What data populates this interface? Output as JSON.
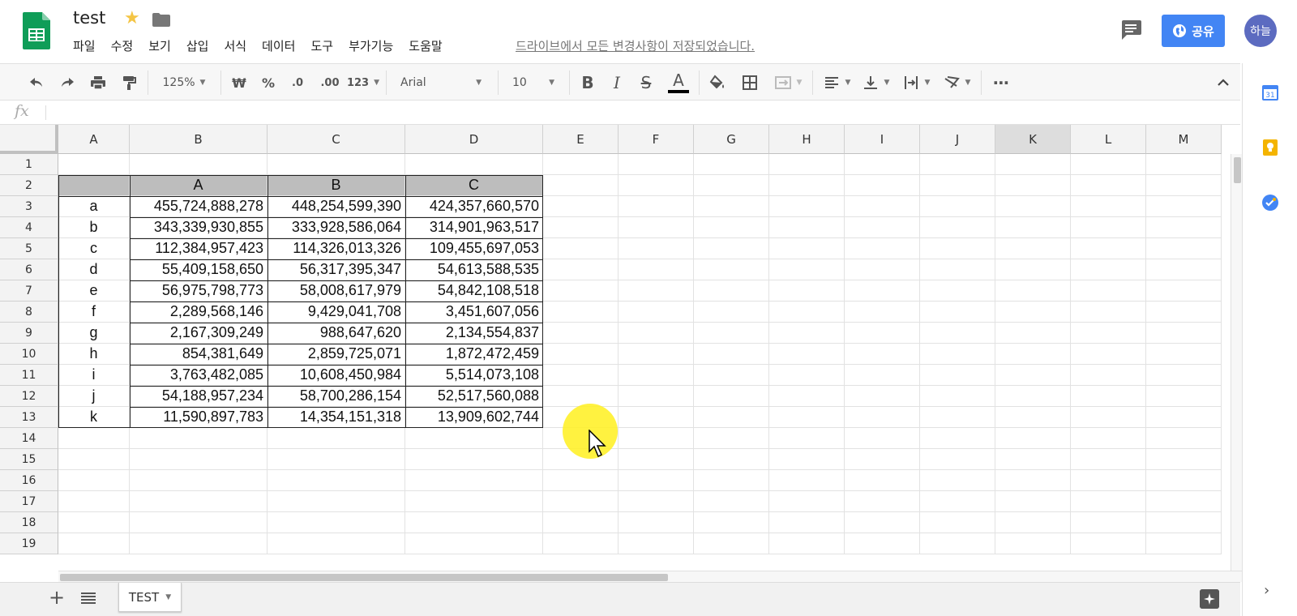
{
  "doc": {
    "title": "test",
    "saved_status": "드라이브에서 모든 변경사항이 저장되었습니다."
  },
  "menu": [
    "파일",
    "수정",
    "보기",
    "삽입",
    "서식",
    "데이터",
    "도구",
    "부가기능",
    "도움말"
  ],
  "header": {
    "share_label": "공유",
    "avatar_label": "하늘"
  },
  "toolbar": {
    "zoom": "125%",
    "currency": "₩",
    "percent": "%",
    "dec_dec": ".0",
    "dec_inc": ".00",
    "format_more": "123",
    "font_name": "Arial",
    "font_size": "10",
    "bold": "B",
    "italic": "I",
    "strike": "S",
    "text_color": "A",
    "more": "⋯"
  },
  "formula": {
    "fx": "fx"
  },
  "columns": [
    "A",
    "B",
    "C",
    "D",
    "E",
    "F",
    "G",
    "H",
    "I",
    "J",
    "K",
    "L",
    "M"
  ],
  "rows": [
    "1",
    "2",
    "3",
    "4",
    "5",
    "6",
    "7",
    "8",
    "9",
    "10",
    "11",
    "12",
    "13",
    "14",
    "15",
    "16",
    "17",
    "18",
    "19"
  ],
  "selected_column": "K",
  "table": {
    "headers": [
      "A",
      "B",
      "C"
    ],
    "rows": [
      {
        "label": "a",
        "values": [
          "455,724,888,278",
          "448,254,599,390",
          "424,357,660,570"
        ]
      },
      {
        "label": "b",
        "values": [
          "343,339,930,855",
          "333,928,586,064",
          "314,901,963,517"
        ]
      },
      {
        "label": "c",
        "values": [
          "112,384,957,423",
          "114,326,013,326",
          "109,455,697,053"
        ]
      },
      {
        "label": "d",
        "values": [
          "55,409,158,650",
          "56,317,395,347",
          "54,613,588,535"
        ]
      },
      {
        "label": "e",
        "values": [
          "56,975,798,773",
          "58,008,617,979",
          "54,842,108,518"
        ]
      },
      {
        "label": "f",
        "values": [
          "2,289,568,146",
          "9,429,041,708",
          "3,451,607,056"
        ]
      },
      {
        "label": "g",
        "values": [
          "2,167,309,249",
          "988,647,620",
          "2,134,554,837"
        ]
      },
      {
        "label": "h",
        "values": [
          "854,381,649",
          "2,859,725,071",
          "1,872,472,459"
        ]
      },
      {
        "label": "i",
        "values": [
          "3,763,482,085",
          "10,608,450,984",
          "5,514,073,108"
        ]
      },
      {
        "label": "j",
        "values": [
          "54,188,957,234",
          "58,700,286,154",
          "52,517,560,088"
        ]
      },
      {
        "label": "k",
        "values": [
          "11,590,897,783",
          "14,354,151,318",
          "13,909,602,744"
        ]
      }
    ]
  },
  "sheet_tabs": [
    {
      "label": "TEST",
      "active": true
    }
  ],
  "colors": {
    "share_button": "#4285f4",
    "sheets_green": "#0f9d58",
    "table_header": "#bdbdbd",
    "cursor_highlight": "#fff01e"
  }
}
